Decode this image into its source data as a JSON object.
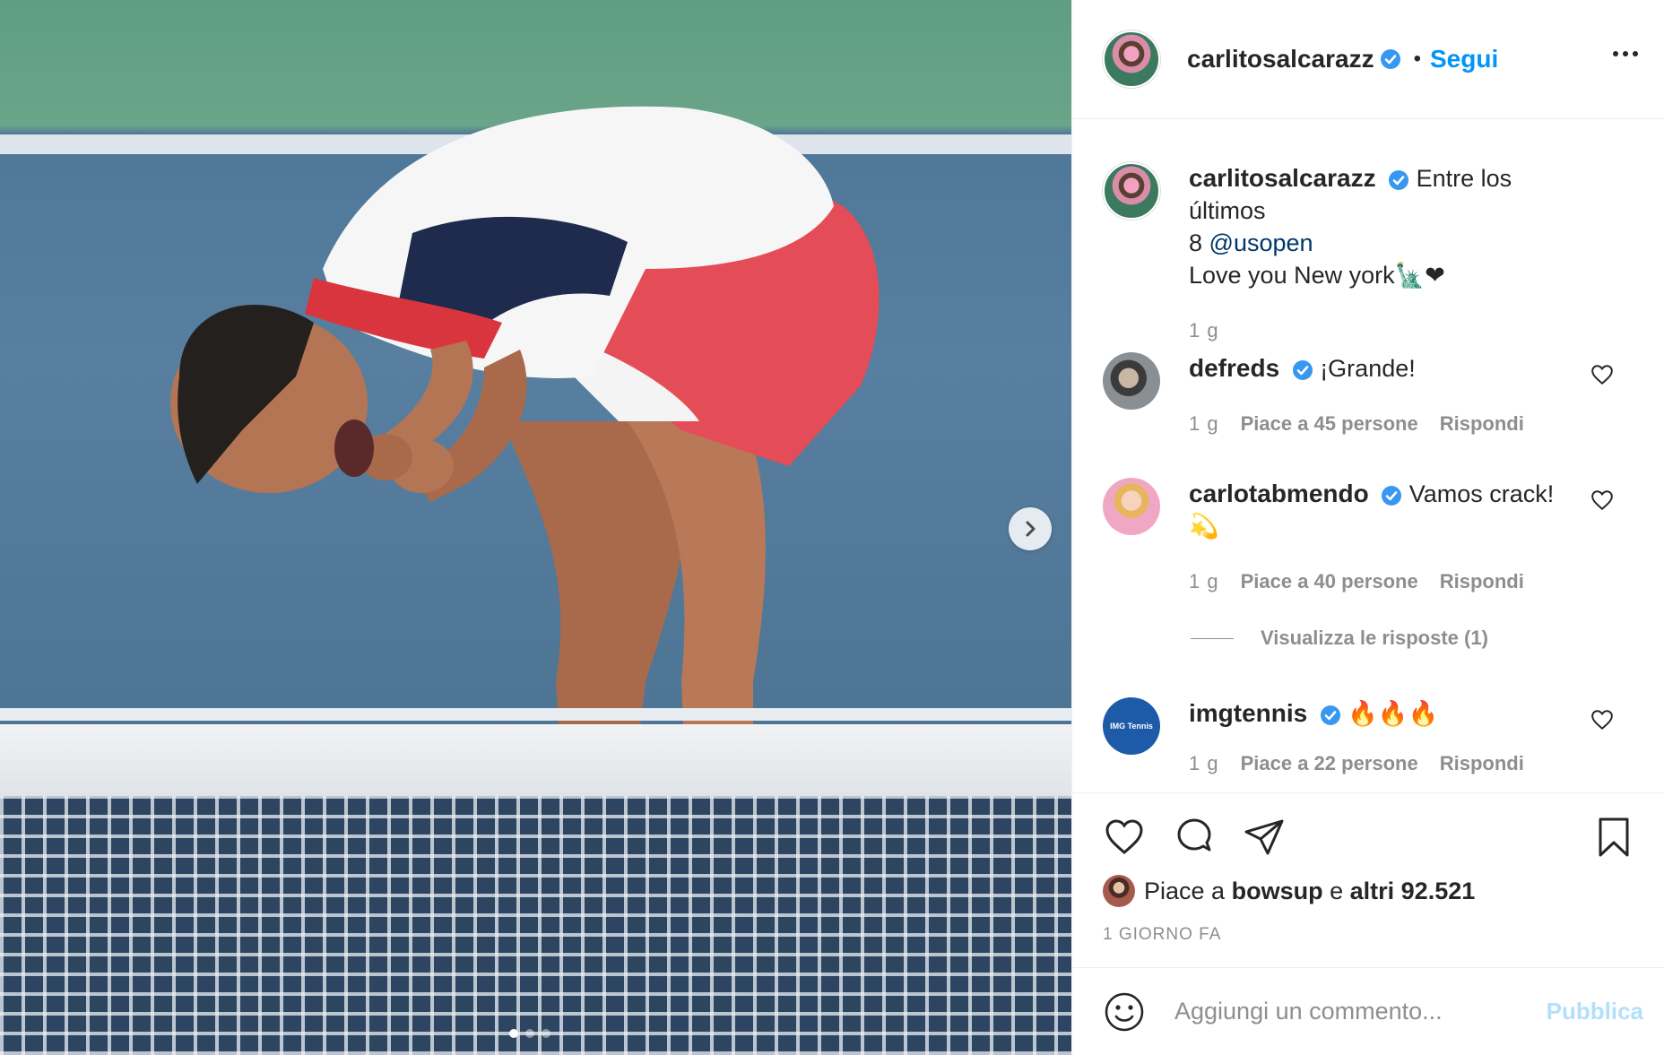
{
  "post": {
    "username": "carlitosalcarazz",
    "follow_label": "Segui",
    "separator": "•",
    "caption_line1": "Entre los últimos",
    "caption_line2_prefix": "8",
    "caption_mention": "@usopen",
    "caption_line3": "Love you New york🗽❤",
    "caption_time": "1 g",
    "carousel": {
      "slide_count": 3,
      "active_index": 0
    }
  },
  "comments": [
    {
      "username": "defreds",
      "text": "¡Grande!",
      "time": "1 g",
      "likes": "Piace a 45 persone",
      "reply": "Rispondi"
    },
    {
      "username": "carlotabmendo",
      "text": "Vamos crack!",
      "text2": "💫",
      "time": "1 g",
      "likes": "Piace a 40 persone",
      "reply": "Rispondi",
      "view_replies": "Visualizza le risposte (1)"
    },
    {
      "username": "imgtennis",
      "text": "🔥🔥🔥",
      "time": "1 g",
      "likes": "Piace a 22 persone",
      "reply": "Rispondi",
      "avatar_text": "IMG Tennis"
    }
  ],
  "likes_summary": {
    "prefix": "Piace a",
    "user": "bowsup",
    "middle": "e",
    "others": "altri 92.521"
  },
  "posted_ago": "1 GIORNO FA",
  "add_comment": {
    "placeholder": "Aggiungi un commento...",
    "publish_label": "Pubblica"
  },
  "colors": {
    "accent": "#0095f6",
    "verified": "#3897f0",
    "publish_disabled": "#b2dffc",
    "meta": "#8e8e8e"
  },
  "icons": [
    "verified-badge-icon",
    "more-options-icon",
    "heart-icon",
    "comment-icon",
    "share-icon",
    "bookmark-icon",
    "emoji-icon",
    "chevron-right-icon"
  ]
}
